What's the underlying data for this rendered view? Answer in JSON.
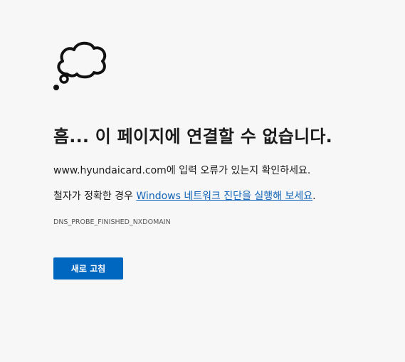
{
  "error": {
    "icon": "thought-cloud-icon",
    "title": "흠... 이 페이지에 연결할 수 없습니다.",
    "domain": "www.hyundaicard.com",
    "check_text": "에 입력 오류가 있는지 확인하세요.",
    "hint_prefix": "철자가 정확한 경우 ",
    "hint_link": "Windows 네트워크 진단을 실행해 보세요",
    "hint_suffix": ".",
    "code": "DNS_PROBE_FINISHED_NXDOMAIN",
    "reload_label": "새로 고침"
  },
  "colors": {
    "background": "#f7f7f7",
    "text": "#1b1b1b",
    "link": "#0e63b8",
    "button": "#0067c0",
    "button_text": "#ffffff"
  }
}
